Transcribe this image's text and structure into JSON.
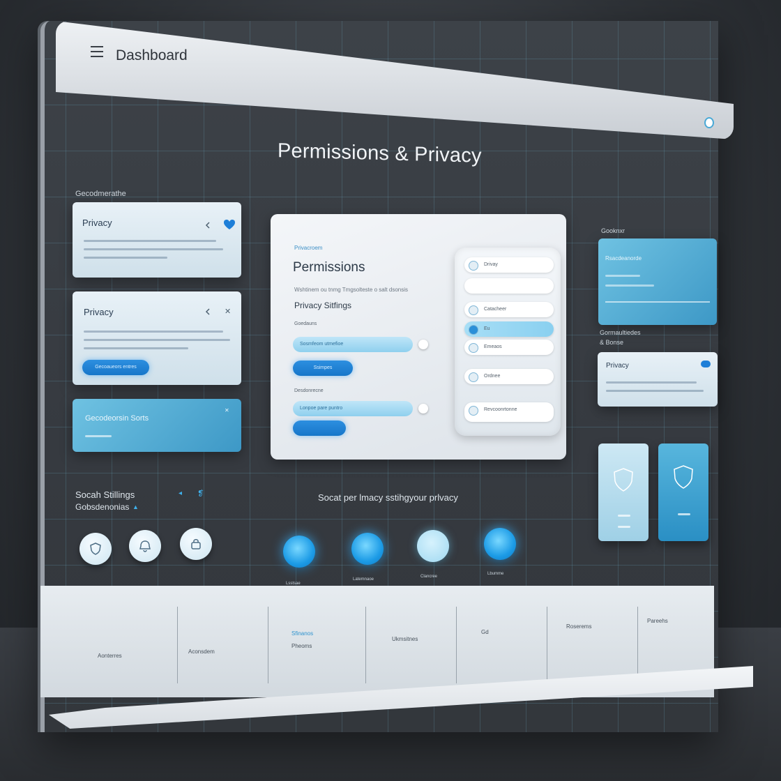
{
  "app": {
    "title": "Dashboard",
    "page_heading": "Permissions & Privacy"
  },
  "left": {
    "group_label": "Gecodmerathe",
    "cards": [
      {
        "title": "Privacy"
      },
      {
        "title": "Privacy",
        "button_label": "Gecoaueors entres"
      },
      {
        "title": "Gecodeorsin Sorts"
      }
    ],
    "settings_label": "Socah Stillings",
    "settings_sub": "Gobsdenonias"
  },
  "center": {
    "eyebrow": "Privacroem",
    "title": "Permissions",
    "subtitle": "Wshtinem ou tnmg Tmgsolteste o salt dsonsis",
    "section_title": "Privacy Sitfings",
    "group1_label": "Goedauns",
    "field1": "Sosmfeom utmefioe",
    "button1": "Ssimpes",
    "group2_label": "Desdonrecne",
    "field2": "Lonpoe pare puntro"
  },
  "toggles": {
    "rows": [
      {
        "label": "Drivay",
        "on": false
      },
      {
        "label": "",
        "on": false
      },
      {
        "label": "Catacheer",
        "on": false
      },
      {
        "label": "Eu",
        "on": true
      },
      {
        "label": "Emeaos",
        "on": false
      },
      {
        "label": "Ordnee",
        "on": false
      },
      {
        "label": "Revcoonrtonne",
        "on": false
      }
    ]
  },
  "right": {
    "top_label": "Gooknxr",
    "top_card_title": "Rsacdeanorde",
    "mid_label": "Gormaultiedes",
    "mid_sub": "& Bonse",
    "privacy_card_title": "Privacy"
  },
  "search_hint": "Socat per lmacy sstihgyour prlvacy",
  "circle_labels": [
    "Lsstsae",
    "Latemnaoe",
    "Clancree",
    "Lbumme"
  ],
  "bottom_strip": {
    "cells": [
      {
        "head": "",
        "text": "Aonterres"
      },
      {
        "head": "",
        "text": "Aconsdem"
      },
      {
        "head": "Sfinanos",
        "text": "Pheoms"
      },
      {
        "head": "",
        "text": "Ukmsitnes"
      },
      {
        "head": "",
        "text": "Gd"
      },
      {
        "head": "",
        "text": "Roserems"
      },
      {
        "head": "",
        "text": "Pareehs"
      }
    ]
  },
  "colors": {
    "accent": "#1e88d8",
    "light_card": "#e3eef5",
    "blue_card": "#4ea8d3",
    "panel": "#3a3f45"
  },
  "icons": [
    "menu-icon",
    "heart-icon",
    "chevron-left-icon",
    "shield-icon",
    "fingerprint-icon"
  ]
}
